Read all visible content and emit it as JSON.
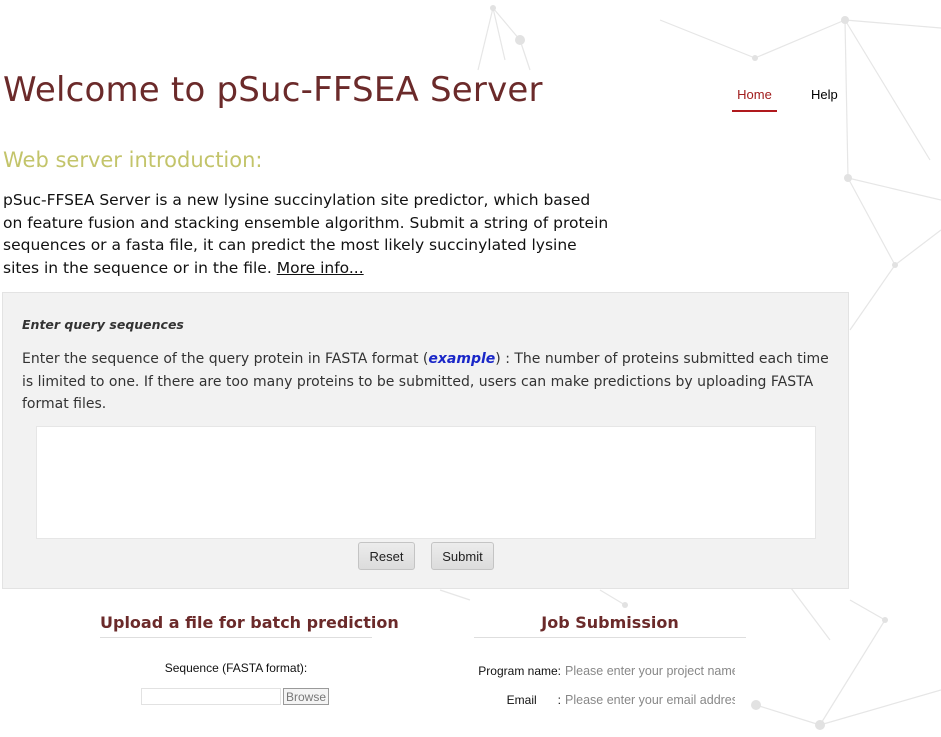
{
  "header": {
    "title": "Welcome to pSuc-FFSEA Server",
    "nav": [
      {
        "label": "Home",
        "active": true
      },
      {
        "label": "Help",
        "active": false
      }
    ],
    "accent_color": "#b0191d"
  },
  "intro": {
    "heading": "Web server introduction:",
    "text": "pSuc-FFSEA Server is a new lysine succinylation site predictor, which based on feature fusion and stacking ensemble algorithm. Submit a string of protein sequences or a fasta file, it can predict the most likely succinylated lysine sites in the sequence or in the file.",
    "more_link": "More info..."
  },
  "query": {
    "title": "Enter query sequences",
    "desc_before": "Enter the sequence of the query protein in FASTA format (",
    "example_link": "example",
    "desc_after": ") : The number of proteins submitted each time is limited to one. If there are too many proteins to be submitted, users can make predictions by uploading FASTA format files.",
    "sequence_value": "",
    "reset_label": "Reset",
    "submit_label": "Submit"
  },
  "upload": {
    "heading": "Upload a file for batch prediction",
    "sequence_label": "Sequence (FASTA format):",
    "file_value": "",
    "browse_label": "Browse"
  },
  "job": {
    "heading": "Job Submission",
    "program_label": "Program name:",
    "program_placeholder": "Please enter your project name",
    "email_label": "Email",
    "email_colon": ":",
    "email_placeholder": "Please enter your email address"
  }
}
